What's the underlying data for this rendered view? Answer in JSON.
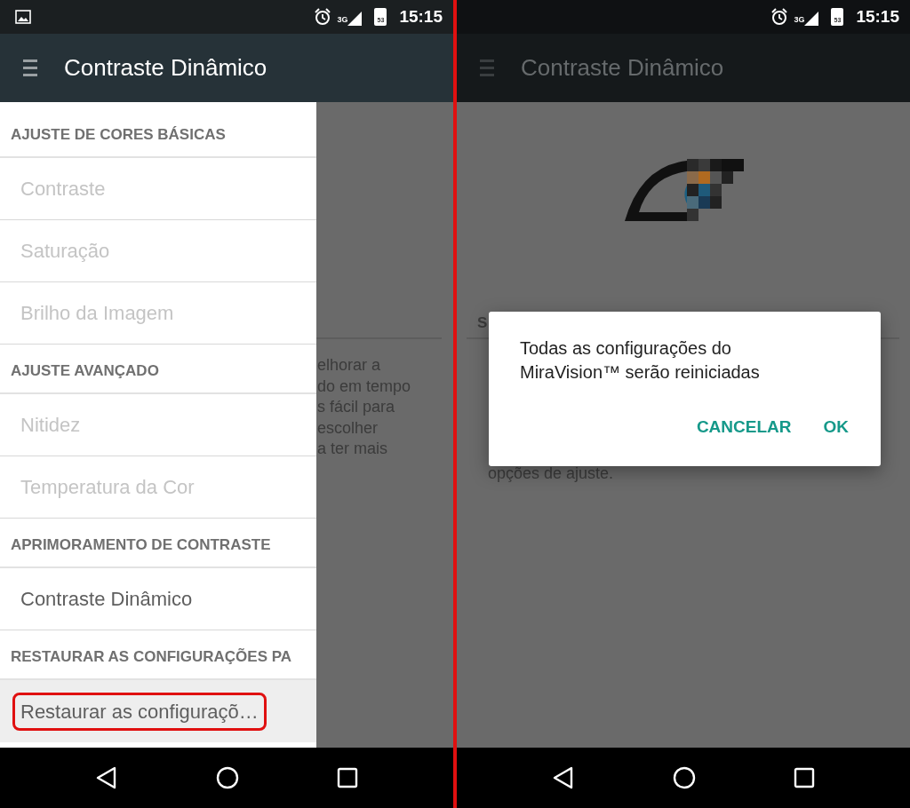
{
  "panes": [
    {
      "status_bar": {
        "notification": true,
        "network": "3G",
        "battery": "53",
        "time": "15:15"
      },
      "app_bar": {
        "title": "Contraste Dinâmico",
        "dimmed": false
      },
      "background_text": [
        "elhorar a",
        "do em tempo",
        "s fácil para",
        "escolher",
        "a ter mais"
      ],
      "drawer": {
        "items": [
          {
            "kind": "header",
            "label": "AJUSTE DE CORES BÁSICAS"
          },
          {
            "kind": "item",
            "label": "Contraste",
            "enabled": false,
            "highlighted": false
          },
          {
            "kind": "item",
            "label": "Saturação",
            "enabled": false,
            "highlighted": false
          },
          {
            "kind": "item",
            "label": "Brilho da Imagem",
            "enabled": false,
            "highlighted": false
          },
          {
            "kind": "header",
            "label": "AJUSTE AVANÇADO"
          },
          {
            "kind": "item",
            "label": "Nitidez",
            "enabled": false,
            "highlighted": false
          },
          {
            "kind": "item",
            "label": "Temperatura da Cor",
            "enabled": false,
            "highlighted": false
          },
          {
            "kind": "header",
            "label": "APRIMORAMENTO DE CONTRASTE"
          },
          {
            "kind": "item",
            "label": "Contraste Dinâmico",
            "enabled": true,
            "highlighted": false
          },
          {
            "kind": "header",
            "label": "RESTAURAR AS CONFIGURAÇÕES PA"
          },
          {
            "kind": "item",
            "label": "Restaurar as configuraçõ…",
            "enabled": true,
            "highlighted": true
          }
        ]
      }
    },
    {
      "status_bar": {
        "notification": false,
        "network": "3G",
        "battery": "53",
        "time": "15:15"
      },
      "app_bar": {
        "title": "Contraste Dinâmico",
        "dimmed": true
      },
      "content": {
        "section_header": "S",
        "text_lines": [
          "opções de ajuste."
        ]
      },
      "dialog": {
        "message": "Todas as configurações do MiraVision™ serão reiniciadas",
        "buttons": [
          "CANCELAR",
          "OK"
        ]
      }
    }
  ]
}
